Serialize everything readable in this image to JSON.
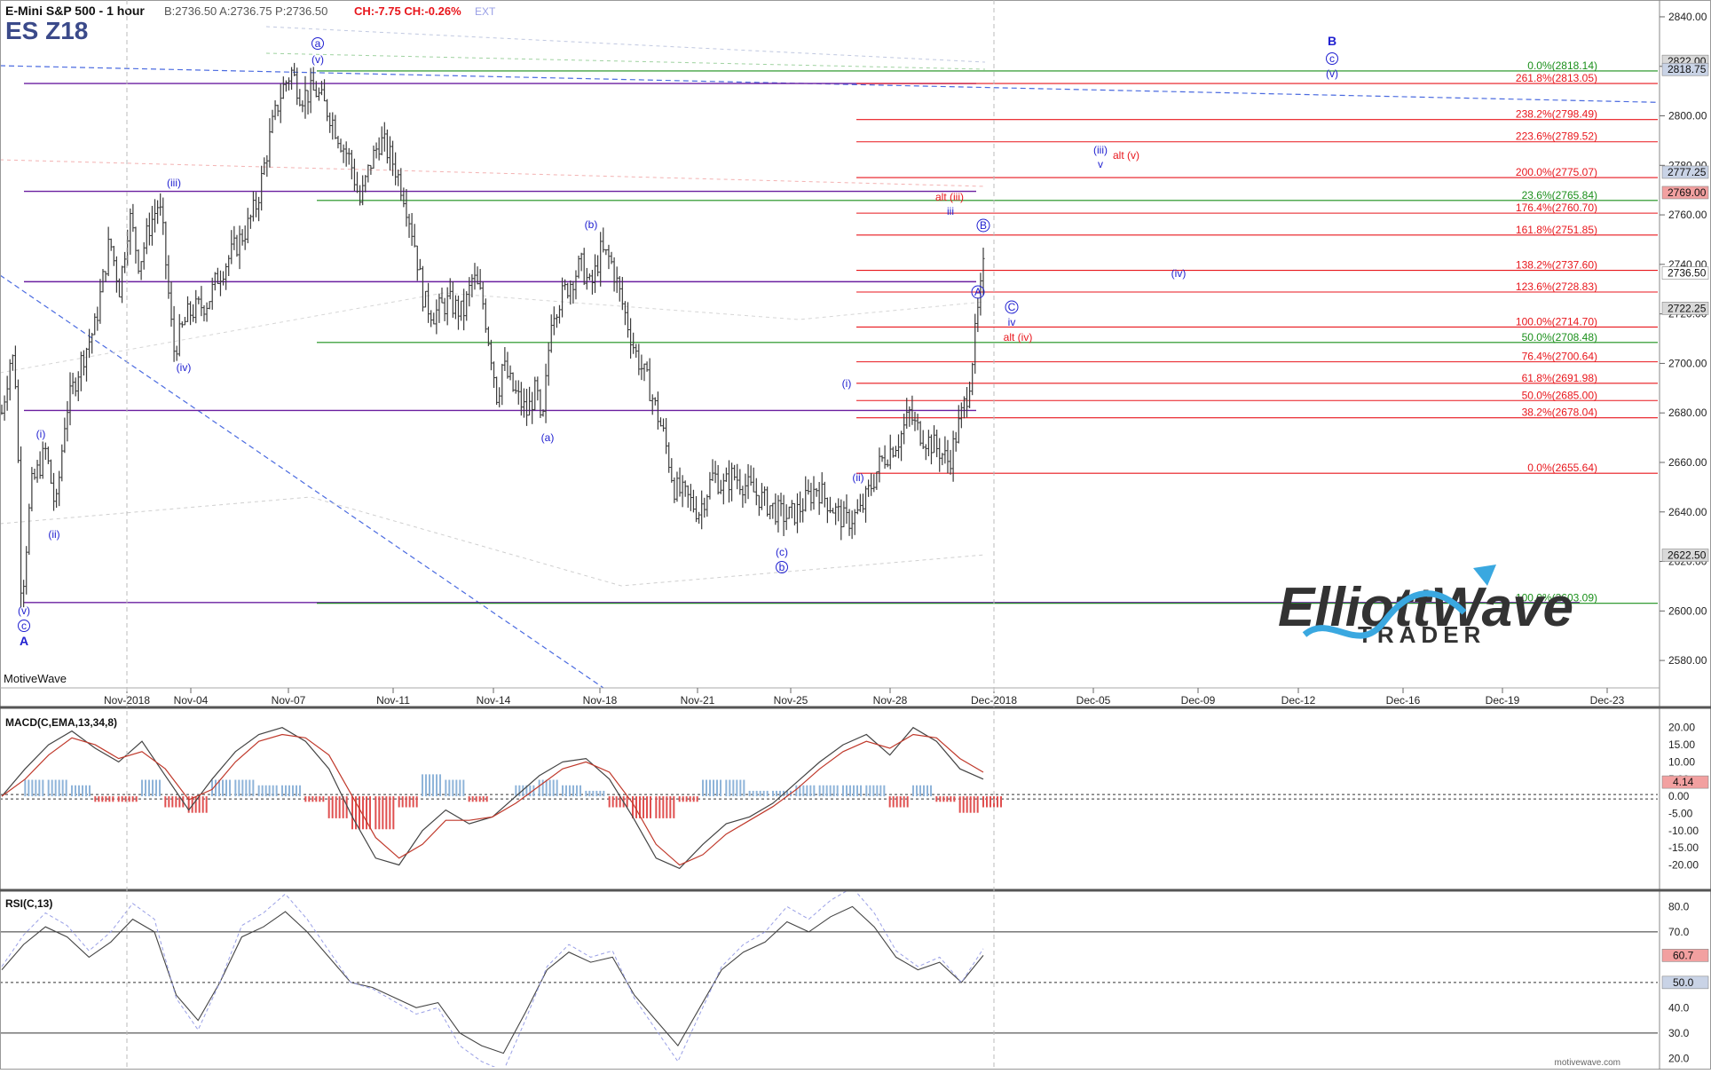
{
  "header": {
    "instrument": "E-Mini S&P 500 - 1 hour",
    "quote": "B:2736.50  A:2736.75  P:2736.50",
    "change": "CH:-7.75  CH:-0.26%",
    "ext": "EXT",
    "symbol": "ES Z18"
  },
  "footer": {
    "left": "MotiveWave",
    "right": "motivewave.com"
  },
  "logo": {
    "text": "ElliottWave",
    "sub": "TRADER"
  },
  "colors": {
    "fib_red": "#e8161c",
    "fib_green": "#1a8f1a",
    "wave_blue": "#1f1fd0",
    "purple": "#6a1fa0",
    "candle": "#3a3a3a",
    "macd_pos": "#8fb4d9",
    "macd_neg": "#e05050",
    "logo_dark": "#333333",
    "logo_blue": "#3aa8e0"
  },
  "chart_data": [
    {
      "type": "candlestick",
      "title": "E-Mini S&P 500 - 1 hour",
      "ylim": [
        2570,
        2845
      ],
      "y_ticks": [
        2580,
        2600,
        2620,
        2640,
        2660,
        2680,
        2700,
        2720,
        2740,
        2760,
        2780,
        2800,
        2820,
        2840
      ],
      "x_ticks": [
        "Nov-2018",
        "Nov-04",
        "Nov-07",
        "Nov-11",
        "Nov-14",
        "Nov-18",
        "Nov-21",
        "Nov-25",
        "Nov-28",
        "Dec-2018",
        "Dec-05",
        "Dec-09",
        "Dec-12",
        "Dec-16",
        "Dec-19",
        "Dec-23"
      ],
      "price_path": [
        [
          0.0,
          2680
        ],
        [
          0.01,
          2705
        ],
        [
          0.015,
          2690
        ],
        [
          0.02,
          2603
        ],
        [
          0.03,
          2650
        ],
        [
          0.045,
          2665
        ],
        [
          0.055,
          2640
        ],
        [
          0.065,
          2680
        ],
        [
          0.08,
          2700
        ],
        [
          0.095,
          2715
        ],
        [
          0.11,
          2750
        ],
        [
          0.12,
          2730
        ],
        [
          0.13,
          2760
        ],
        [
          0.14,
          2740
        ],
        [
          0.15,
          2755
        ],
        [
          0.16,
          2765
        ],
        [
          0.165,
          2750
        ],
        [
          0.175,
          2705
        ],
        [
          0.19,
          2720
        ],
        [
          0.21,
          2725
        ],
        [
          0.22,
          2735
        ],
        [
          0.235,
          2745
        ],
        [
          0.25,
          2755
        ],
        [
          0.26,
          2765
        ],
        [
          0.275,
          2795
        ],
        [
          0.285,
          2810
        ],
        [
          0.295,
          2818
        ],
        [
          0.305,
          2808
        ],
        [
          0.32,
          2810
        ],
        [
          0.335,
          2800
        ],
        [
          0.345,
          2790
        ],
        [
          0.355,
          2782
        ],
        [
          0.365,
          2765
        ],
        [
          0.375,
          2780
        ],
        [
          0.385,
          2790
        ],
        [
          0.39,
          2788
        ],
        [
          0.4,
          2780
        ],
        [
          0.41,
          2768
        ],
        [
          0.42,
          2750
        ],
        [
          0.43,
          2725
        ],
        [
          0.44,
          2720
        ],
        [
          0.455,
          2725
        ],
        [
          0.47,
          2720
        ],
        [
          0.48,
          2735
        ],
        [
          0.49,
          2725
        ],
        [
          0.5,
          2700
        ],
        [
          0.505,
          2685
        ],
        [
          0.51,
          2700
        ],
        [
          0.52,
          2690
        ],
        [
          0.535,
          2680
        ],
        [
          0.545,
          2690
        ],
        [
          0.55,
          2670
        ],
        [
          0.56,
          2720
        ],
        [
          0.575,
          2730
        ],
        [
          0.59,
          2740
        ],
        [
          0.6,
          2730
        ],
        [
          0.61,
          2745
        ],
        [
          0.62,
          2742
        ],
        [
          0.625,
          2735
        ],
        [
          0.635,
          2720
        ],
        [
          0.645,
          2705
        ],
        [
          0.66,
          2690
        ],
        [
          0.675,
          2670
        ],
        [
          0.685,
          2650
        ],
        [
          0.7,
          2645
        ],
        [
          0.71,
          2640
        ],
        [
          0.715,
          2645
        ],
        [
          0.725,
          2655
        ],
        [
          0.735,
          2650
        ],
        [
          0.745,
          2655
        ],
        [
          0.76,
          2650
        ],
        [
          0.775,
          2645
        ],
        [
          0.79,
          2640
        ],
        [
          0.8,
          2638
        ],
        [
          0.81,
          2640
        ],
        [
          0.82,
          2645
        ],
        [
          0.83,
          2650
        ],
        [
          0.84,
          2645
        ],
        [
          0.85,
          2640
        ],
        [
          0.86,
          2636
        ],
        [
          0.875,
          2640
        ],
        [
          0.885,
          2650
        ],
        [
          0.895,
          2660
        ],
        [
          0.905,
          2665
        ],
        [
          0.915,
          2670
        ],
        [
          0.925,
          2680
        ],
        [
          0.93,
          2675
        ],
        [
          0.94,
          2670
        ],
        [
          0.955,
          2665
        ],
        [
          0.965,
          2660
        ],
        [
          0.975,
          2675
        ],
        [
          0.985,
          2690
        ],
        [
          1.0,
          2738
        ]
      ],
      "price_path_2": [
        [
          0.0,
          2680
        ],
        [
          0.03,
          2700
        ],
        [
          0.05,
          2690
        ],
        [
          0.07,
          2705
        ],
        [
          0.09,
          2730
        ],
        [
          0.12,
          2745
        ],
        [
          0.15,
          2744
        ],
        [
          0.18,
          2740
        ],
        [
          0.22,
          2744
        ],
        [
          0.26,
          2740
        ],
        [
          0.29,
          2735
        ],
        [
          0.33,
          2745
        ],
        [
          0.37,
          2740
        ],
        [
          0.4,
          2750
        ],
        [
          0.43,
          2738
        ],
        [
          0.46,
          2742
        ],
        [
          0.49,
          2730
        ],
        [
          0.52,
          2745
        ],
        [
          0.55,
          2748
        ],
        [
          0.58,
          2740
        ],
        [
          0.61,
          2752
        ],
        [
          0.64,
          2740
        ],
        [
          0.67,
          2738
        ],
        [
          0.7,
          2745
        ],
        [
          0.73,
          2735
        ],
        [
          0.76,
          2728
        ],
        [
          0.79,
          2732
        ],
        [
          0.82,
          2730
        ],
        [
          0.85,
          2738
        ],
        [
          0.88,
          2735
        ],
        [
          0.91,
          2740
        ],
        [
          0.94,
          2745
        ],
        [
          0.97,
          2740
        ],
        [
          1.0,
          2736.5
        ]
      ],
      "series": [
        {
          "name": "0.0%",
          "value": 2818.14,
          "label": "0.0%(2818.14)"
        },
        {
          "name": "261.8%",
          "value": 2813.05,
          "label": "261.8%(2813.05)"
        },
        {
          "name": "238.2%",
          "value": 2798.49,
          "label": "238.2%(2798.49)"
        },
        {
          "name": "223.6%",
          "value": 2789.52,
          "label": "223.6%(2789.52)"
        },
        {
          "name": "200.0%",
          "value": 2775.07,
          "label": "200.0%(2775.07)"
        },
        {
          "name": "23.6%",
          "value": 2765.84,
          "label": "23.6%(2765.84)"
        },
        {
          "name": "176.4%",
          "value": 2760.7,
          "label": "176.4%(2760.70)"
        },
        {
          "name": "161.8%",
          "value": 2751.85,
          "label": "161.8%(2751.85)"
        },
        {
          "name": "138.2%",
          "value": 2737.6,
          "label": "138.2%(2737.60)"
        },
        {
          "name": "123.6%",
          "value": 2728.83,
          "label": "123.6%(2728.83)"
        },
        {
          "name": "100.0%",
          "value": 2714.7,
          "label": "100.0%(2714.70)"
        },
        {
          "name": "50.0%",
          "value": 2708.48,
          "label": "50.0%(2708.48)"
        },
        {
          "name": "76.4%",
          "value": 2700.64,
          "label": "76.4%(2700.64)"
        },
        {
          "name": "61.8%",
          "value": 2691.98,
          "label": "61.8%(2691.98)"
        },
        {
          "name": "50.0%",
          "value": 2685.0,
          "label": "50.0%(2685.00)"
        },
        {
          "name": "38.2%",
          "value": 2678.04,
          "label": "38.2%(2678.04)"
        },
        {
          "name": "0.0%",
          "value": 2655.64,
          "label": "0.0%(2655.64)"
        },
        {
          "name": "100.0%",
          "value": 2603.09,
          "label": "100.0%(2603.09)"
        }
      ],
      "fib_levels": [
        {
          "label": "0.0%(2818.14)",
          "value": 2818.14,
          "color": "#1a8f1a"
        },
        {
          "label": "261.8%(2813.05)",
          "value": 2813.05,
          "color": "#e8161c"
        },
        {
          "label": "238.2%(2798.49)",
          "value": 2798.49,
          "color": "#e8161c"
        },
        {
          "label": "223.6%(2789.52)",
          "value": 2789.52,
          "color": "#e8161c"
        },
        {
          "label": "200.0%(2775.07)",
          "value": 2775.07,
          "color": "#e8161c"
        },
        {
          "label": "23.6%(2765.84)",
          "value": 2765.84,
          "color": "#1a8f1a"
        },
        {
          "label": "176.4%(2760.70)",
          "value": 2760.7,
          "color": "#e8161c"
        },
        {
          "label": "161.8%(2751.85)",
          "value": 2751.85,
          "color": "#e8161c"
        },
        {
          "label": "138.2%(2737.60)",
          "value": 2737.6,
          "color": "#e8161c"
        },
        {
          "label": "123.6%(2728.83)",
          "value": 2728.83,
          "color": "#e8161c"
        },
        {
          "label": "100.0%(2714.70)",
          "value": 2714.7,
          "color": "#e8161c"
        },
        {
          "label": "50.0%(2708.48)",
          "value": 2708.48,
          "color": "#1a8f1a"
        },
        {
          "label": "76.4%(2700.64)",
          "value": 2700.64,
          "color": "#e8161c"
        },
        {
          "label": "61.8%(2691.98)",
          "value": 2691.98,
          "color": "#e8161c"
        },
        {
          "label": "50.0%(2685.00)",
          "value": 2685.0,
          "color": "#e8161c"
        },
        {
          "label": "38.2%(2678.04)",
          "value": 2678.04,
          "color": "#e8161c"
        },
        {
          "label": "0.0%(2655.64)",
          "value": 2655.64,
          "color": "#e8161c"
        },
        {
          "label": "100.0%(2603.09)",
          "value": 2603.09,
          "color": "#1a8f1a"
        }
      ],
      "price_tags": [
        {
          "label": "2822.00",
          "value": 2822.0,
          "fill": "#d9d9d9"
        },
        {
          "label": "2818.75",
          "value": 2818.75,
          "fill": "#c9d3e6"
        },
        {
          "label": "2777.25",
          "value": 2777.25,
          "fill": "#c9d3e6"
        },
        {
          "label": "2769.00",
          "value": 2769.0,
          "fill": "#f2a0a0"
        },
        {
          "label": "2736.50",
          "value": 2736.5,
          "fill": "#ffffff"
        },
        {
          "label": "2722.25",
          "value": 2722.25,
          "fill": "#d9d9d9"
        },
        {
          "label": "2622.50",
          "value": 2622.5,
          "fill": "#d9d9d9"
        }
      ],
      "wave_labels": [
        {
          "text": "ⓐ",
          "x": 0.0,
          "y": 0.0
        },
        {
          "text": "(v)",
          "x": 0.0,
          "y": 0.0
        },
        {
          "text": "(iii)",
          "x": 0.0,
          "y": 0.0
        },
        {
          "text": "(iv)",
          "x": 0.0,
          "y": 0.0
        },
        {
          "text": "(i)",
          "x": 0.0,
          "y": 0.0
        },
        {
          "text": "(ii)",
          "x": 0.0,
          "y": 0.0
        },
        {
          "text": "(v)",
          "x": 0.0,
          "y": 0.0
        },
        {
          "text": "ⓒ",
          "x": 0.0,
          "y": 0.0
        },
        {
          "text": "A",
          "x": 0.0,
          "y": 0.0
        },
        {
          "text": "(b)",
          "x": 0.0,
          "y": 0.0
        },
        {
          "text": "(a)",
          "x": 0.0,
          "y": 0.0
        },
        {
          "text": "(c)",
          "x": 0.0,
          "y": 0.0
        },
        {
          "text": "ⓑ",
          "x": 0.0,
          "y": 0.0
        },
        {
          "text": "(i)",
          "x": 0.0,
          "y": 0.0
        },
        {
          "text": "(ii)",
          "x": 0.0,
          "y": 0.0
        },
        {
          "text": "alt (iii)",
          "x": 0.0,
          "y": 0.0
        },
        {
          "text": "iii",
          "x": 0.0,
          "y": 0.0
        },
        {
          "text": "Ⓑ",
          "x": 0.0,
          "y": 0.0
        },
        {
          "text": "Ⓐ",
          "x": 0.0,
          "y": 0.0
        },
        {
          "text": "Ⓒ",
          "x": 0.0,
          "y": 0.0
        },
        {
          "text": "iv",
          "x": 0.0,
          "y": 0.0
        },
        {
          "text": "alt (iv)",
          "x": 0.0,
          "y": 0.0
        },
        {
          "text": "(iii)",
          "x": 0.0,
          "y": 0.0
        },
        {
          "text": "v",
          "x": 0.0,
          "y": 0.0
        },
        {
          "text": "alt (v)",
          "x": 0.0,
          "y": 0.0
        },
        {
          "text": "(iv)",
          "x": 0.0,
          "y": 0.0
        },
        {
          "text": "B",
          "x": 0.0,
          "y": 0.0
        },
        {
          "text": "ⓒ",
          "x": 0.0,
          "y": 0.0
        },
        {
          "text": "(v)",
          "x": 0.0,
          "y": 0.0
        }
      ]
    },
    {
      "type": "line",
      "title": "MACD(C,EMA,13,34,8)",
      "ylim": [
        -24,
        22
      ],
      "y_ticks": [
        20,
        15,
        10,
        5,
        0,
        -5,
        -10,
        -15,
        -20
      ],
      "y_tick_labels": [
        "20.00",
        "15.00",
        "10.00",
        "5.00",
        "0.00",
        "-5.00",
        "-10.00",
        "-15.00",
        "-20.00"
      ],
      "last_value_tag": "4.14",
      "series": [
        {
          "name": "MACD",
          "values": [
            0,
            8,
            15,
            19,
            14,
            10,
            16,
            6,
            -4,
            5,
            13,
            18,
            20,
            16,
            8,
            -6,
            -18,
            -20,
            -10,
            -4,
            -8,
            -6,
            0,
            6,
            10,
            11,
            5,
            -6,
            -18,
            -21,
            -14,
            -8,
            -6,
            -2,
            4,
            10,
            15,
            18,
            12,
            20,
            16,
            8,
            5
          ]
        },
        {
          "name": "Signal",
          "values": [
            0,
            5,
            12,
            17,
            15,
            11,
            13,
            8,
            -1,
            2,
            10,
            16,
            18,
            17,
            12,
            0,
            -12,
            -18,
            -14,
            -7,
            -7,
            -6,
            -2,
            3,
            8,
            10,
            7,
            -2,
            -14,
            -20,
            -17,
            -11,
            -7,
            -3,
            2,
            8,
            13,
            16,
            14,
            18,
            17,
            11,
            7
          ]
        }
      ]
    },
    {
      "type": "line",
      "title": "RSI(C,13)",
      "ylim": [
        18,
        84
      ],
      "y_ticks": [
        80,
        70,
        60,
        50,
        40,
        30,
        20
      ],
      "y_tick_labels": [
        "80.0",
        "70.0",
        "60.0",
        "50.0",
        "40.0",
        "30.0",
        "20.0"
      ],
      "reference_lines": [
        70,
        50,
        30
      ],
      "last_value_tag": "60.7",
      "mid_tag": "50.0",
      "series": [
        {
          "name": "RSI",
          "values": [
            55,
            65,
            72,
            68,
            60,
            66,
            75,
            70,
            45,
            35,
            50,
            68,
            72,
            78,
            70,
            60,
            50,
            48,
            44,
            40,
            42,
            30,
            25,
            22,
            38,
            55,
            62,
            58,
            60,
            45,
            35,
            25,
            40,
            55,
            62,
            66,
            74,
            70,
            76,
            80,
            72,
            60,
            55,
            58,
            50,
            60.7
          ]
        }
      ]
    }
  ]
}
